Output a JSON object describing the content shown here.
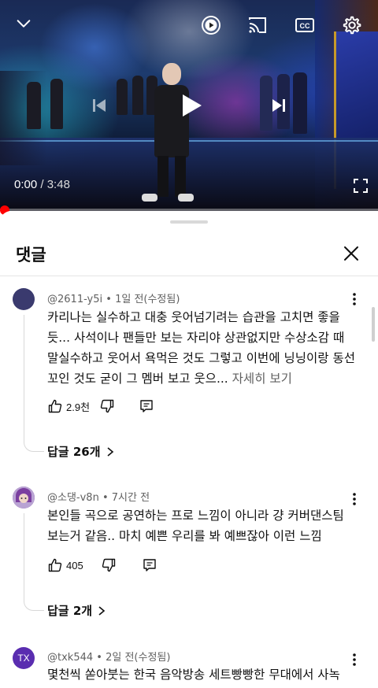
{
  "player": {
    "current_time": "0:00",
    "duration": "3:48",
    "progress_fraction": 0.0,
    "icons": [
      "chevron-down-icon",
      "autoplay-icon",
      "cast-icon",
      "captions-icon",
      "settings-icon",
      "previous-icon",
      "play-icon",
      "next-icon",
      "fullscreen-icon"
    ]
  },
  "comments_panel": {
    "title": "댓글",
    "comments": [
      {
        "author": "@2611-y5i",
        "time": "1일 전(수정됨)",
        "text": "카리나는 실수하고 대충 웃어넘기려는 습관을 고치면 좋을 듯... 사석이나 팬들만 보는 자리야 상관없지만 수상소감 때 말실수하고 웃어서 욕먹은 것도 그렇고 이번에 닝닝이랑 동선 꼬인 것도 굳이 그 멤버 보고 웃으...",
        "more_label": "자세히 보기",
        "likes": "2.9천",
        "replies_label": "답글 26개",
        "avatar_color": "#3a3a6e"
      },
      {
        "author": "@소댕-v8n",
        "time": "7시간 전",
        "text": "본인들 곡으로 공연하는 프로 느낌이 아니라 걍 커버댄스팀 보는거 같음.. 마치 예쁜 우리를 봐 예쁘잖아 이런 느낌",
        "likes": "405",
        "replies_label": "답글 2개",
        "avatar_color": "#8a5aa8"
      },
      {
        "author": "@txk544",
        "time": "2일 전(수정됨)",
        "text": "몇천씩 쏟아붓는 한국 음악방송 세트빵빵한 무대에서 사녹",
        "avatar_initials": "TX",
        "avatar_color": "#5a2db0"
      }
    ]
  },
  "colors": {
    "progress": "#ff0000",
    "text_primary": "#0f0f0f",
    "text_secondary": "#606060"
  }
}
